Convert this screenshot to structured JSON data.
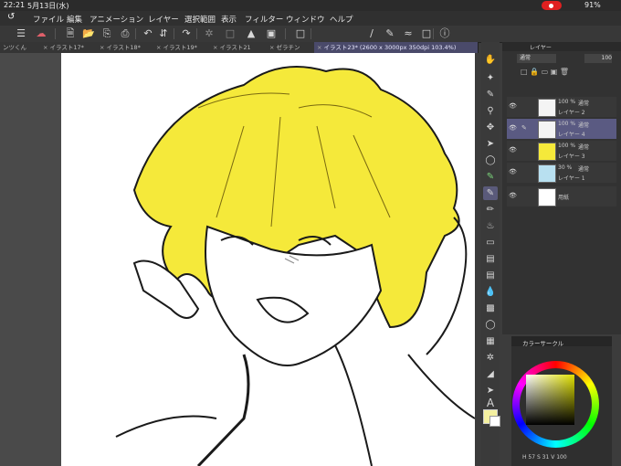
{
  "status": {
    "time": "22:21",
    "date": "5月13日(水)",
    "battery": "91%"
  },
  "menu": [
    "ファイル",
    "編集",
    "アニメーション",
    "レイヤー",
    "選択範囲",
    "表示",
    "フィルター",
    "ウィンドウ",
    "ヘルプ"
  ],
  "tabs": [
    {
      "label": "ンツくん"
    },
    {
      "label": "イラスト17*"
    },
    {
      "label": "イラスト18*"
    },
    {
      "label": "イラスト19*"
    },
    {
      "label": "イラスト21"
    },
    {
      "label": "ゼラチン"
    },
    {
      "label": "イラスト23* (2600 x 3000px 350dpi 103.4%)",
      "active": true
    }
  ],
  "layer_panel": {
    "title": "レイヤー",
    "blend_mode": "通常",
    "opacity": "100",
    "layers": [
      {
        "opacity_label": "100 %",
        "blend": "通常",
        "name": "レイヤー 2"
      },
      {
        "opacity_label": "100 %",
        "blend": "通常",
        "name": "レイヤー 4",
        "selected": true
      },
      {
        "opacity_label": "100 %",
        "blend": "通常",
        "name": "レイヤー 3"
      },
      {
        "opacity_label": "30 %",
        "blend": "通常",
        "name": "レイヤー 1"
      },
      {
        "opacity_label": "",
        "blend": "",
        "name": "用紙"
      }
    ]
  },
  "color_panel": {
    "title": "カラーサークル",
    "hsv": "H 57  S 31  V 100",
    "main_color": "#f4f0a0"
  },
  "colors": {
    "hair": "#f5e93a",
    "accent": "#e02020",
    "selection": "#5a5a82"
  },
  "icons": [
    "menu-icon",
    "cloud-icon",
    "new-file-icon",
    "open-icon",
    "save-icon",
    "undo-icon",
    "redo-icon",
    "rotate-icon",
    "fill-icon",
    "transform-icon",
    "ruler-icon",
    "eyedropper-icon",
    "help-icon"
  ]
}
